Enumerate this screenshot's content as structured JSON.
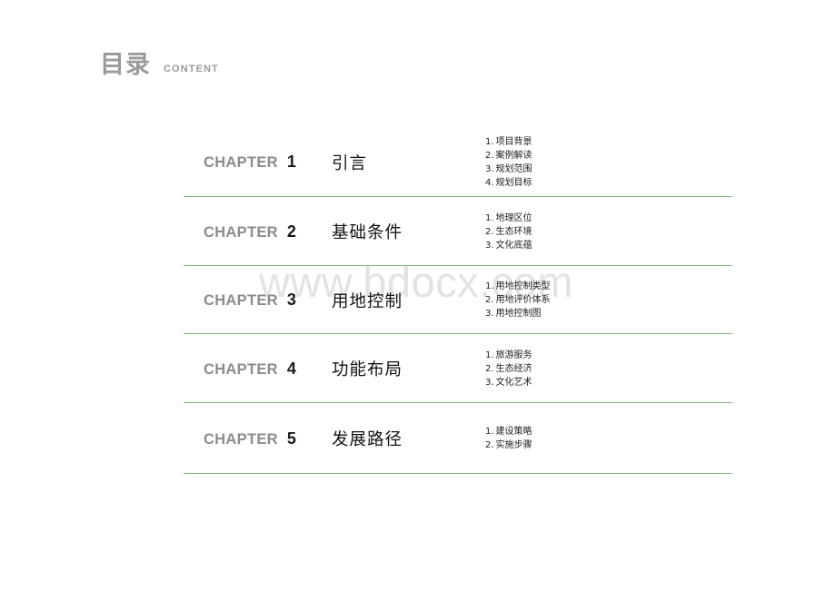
{
  "header": {
    "title_cn": "目录",
    "title_en": "CONTENT"
  },
  "watermark": {
    "text": "www.bdocx.com"
  },
  "colors": {
    "divider": "#7fba7a",
    "header_gray": "#9a9a9a",
    "chapter_label_gray": "#8c8c8c",
    "title_dark": "#111111",
    "watermark_gray": "#e3e3e3"
  },
  "toc": {
    "chapter_word": "CHAPTER",
    "rows": [
      {
        "number": "1",
        "title": "引言",
        "items": [
          {
            "idx": "1.",
            "label": "项目背景"
          },
          {
            "idx": "2.",
            "label": "案例解读"
          },
          {
            "idx": "3.",
            "label": "规划范围"
          },
          {
            "idx": "4.",
            "label": "规划目标"
          }
        ]
      },
      {
        "number": "2",
        "title": "基础条件",
        "items": [
          {
            "idx": "1.",
            "label": "地理区位"
          },
          {
            "idx": "2.",
            "label": "生态环境"
          },
          {
            "idx": "3.",
            "label": "文化底蕴"
          }
        ]
      },
      {
        "number": "3",
        "title": "用地控制",
        "items": [
          {
            "idx": "1.",
            "label": "用地控制类型"
          },
          {
            "idx": "2.",
            "label": "用地评价体系"
          },
          {
            "idx": "3.",
            "label": "用地控制图"
          }
        ]
      },
      {
        "number": "4",
        "title": "功能布局",
        "items": [
          {
            "idx": "1.",
            "label": "旅游服务"
          },
          {
            "idx": "2.",
            "label": "生态经济"
          },
          {
            "idx": "3.",
            "label": "文化艺术"
          }
        ]
      },
      {
        "number": "5",
        "title": "发展路径",
        "items": [
          {
            "idx": "1.",
            "label": "建设策略"
          },
          {
            "idx": "2.",
            "label": "实施步骤"
          }
        ]
      }
    ]
  }
}
